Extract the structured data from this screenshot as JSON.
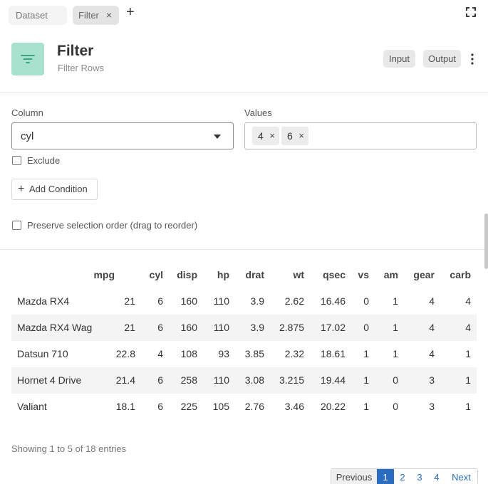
{
  "tabs": [
    {
      "label": "Dataset"
    },
    {
      "label": "Filter",
      "close": "×"
    }
  ],
  "add_tab": "+",
  "header": {
    "title": "Filter",
    "subtitle": "Filter Rows",
    "input_label": "Input",
    "output_label": "Output",
    "accent_color": "#a8e2cf",
    "icon": "filter-icon"
  },
  "form": {
    "column_label": "Column",
    "column_value": "cyl",
    "values_label": "Values",
    "values": [
      "4",
      "6"
    ],
    "chip_remove": "×",
    "exclude_label": "Exclude",
    "add_condition_label": "Add Condition",
    "add_condition_plus": "+",
    "preserve_label": "Preserve selection order (drag to reorder)"
  },
  "table": {
    "columns": [
      "",
      "mpg",
      "cyl",
      "disp",
      "hp",
      "drat",
      "wt",
      "qsec",
      "vs",
      "am",
      "gear",
      "carb"
    ],
    "rows": [
      [
        "Mazda RX4",
        "21",
        "6",
        "160",
        "110",
        "3.9",
        "2.62",
        "16.46",
        "0",
        "1",
        "4",
        "4"
      ],
      [
        "Mazda RX4 Wag",
        "21",
        "6",
        "160",
        "110",
        "3.9",
        "2.875",
        "17.02",
        "0",
        "1",
        "4",
        "4"
      ],
      [
        "Datsun 710",
        "22.8",
        "4",
        "108",
        "93",
        "3.85",
        "2.32",
        "18.61",
        "1",
        "1",
        "4",
        "1"
      ],
      [
        "Hornet 4 Drive",
        "21.4",
        "6",
        "258",
        "110",
        "3.08",
        "3.215",
        "19.44",
        "1",
        "0",
        "3",
        "1"
      ],
      [
        "Valiant",
        "18.1",
        "6",
        "225",
        "105",
        "2.76",
        "3.46",
        "20.22",
        "1",
        "0",
        "3",
        "1"
      ]
    ]
  },
  "info": "Showing 1 to 5 of 18 entries",
  "pagination": {
    "previous": "Previous",
    "pages": [
      "1",
      "2",
      "3",
      "4"
    ],
    "next": "Next",
    "active_color": "#2a6cc0"
  }
}
